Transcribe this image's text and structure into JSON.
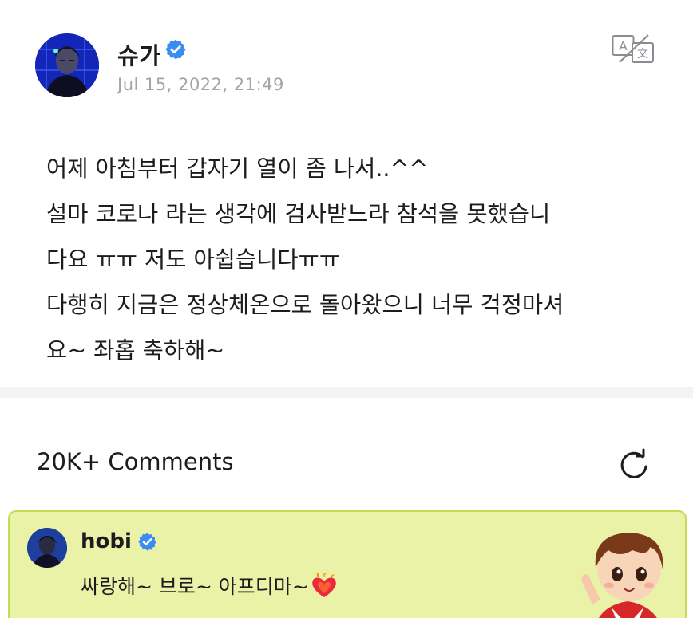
{
  "post": {
    "author": "슈가",
    "date": "Jul 15, 2022, 21:49",
    "body_lines": [
      "어제 아침부터 갑자기 열이 좀 나서..^^",
      "설마 코로나 라는 생각에 검사받느라 참석을 못했습니",
      "다요 ㅠㅠ 저도 아쉽습니다ㅠㅠ",
      "다행히 지금은 정상체온으로 돌아왔으니 너무 걱정마셔",
      "요~ 좌홉 축하해~"
    ]
  },
  "comments": {
    "title": "20K+ Comments",
    "highlighted": {
      "author": "hobi",
      "text": "싸랑해~ 브로~ 아프디마~"
    }
  },
  "icons": {
    "verified": "verified-badge-icon",
    "translate": "translate-icon",
    "refresh": "refresh-icon",
    "emoji": "heart-on-fire-icon"
  },
  "colors": {
    "verified_blue": "#3a8df0",
    "date_gray": "#a3a5ab",
    "highlight_background": "#e9f2a7",
    "highlight_border": "#c4dd55"
  }
}
